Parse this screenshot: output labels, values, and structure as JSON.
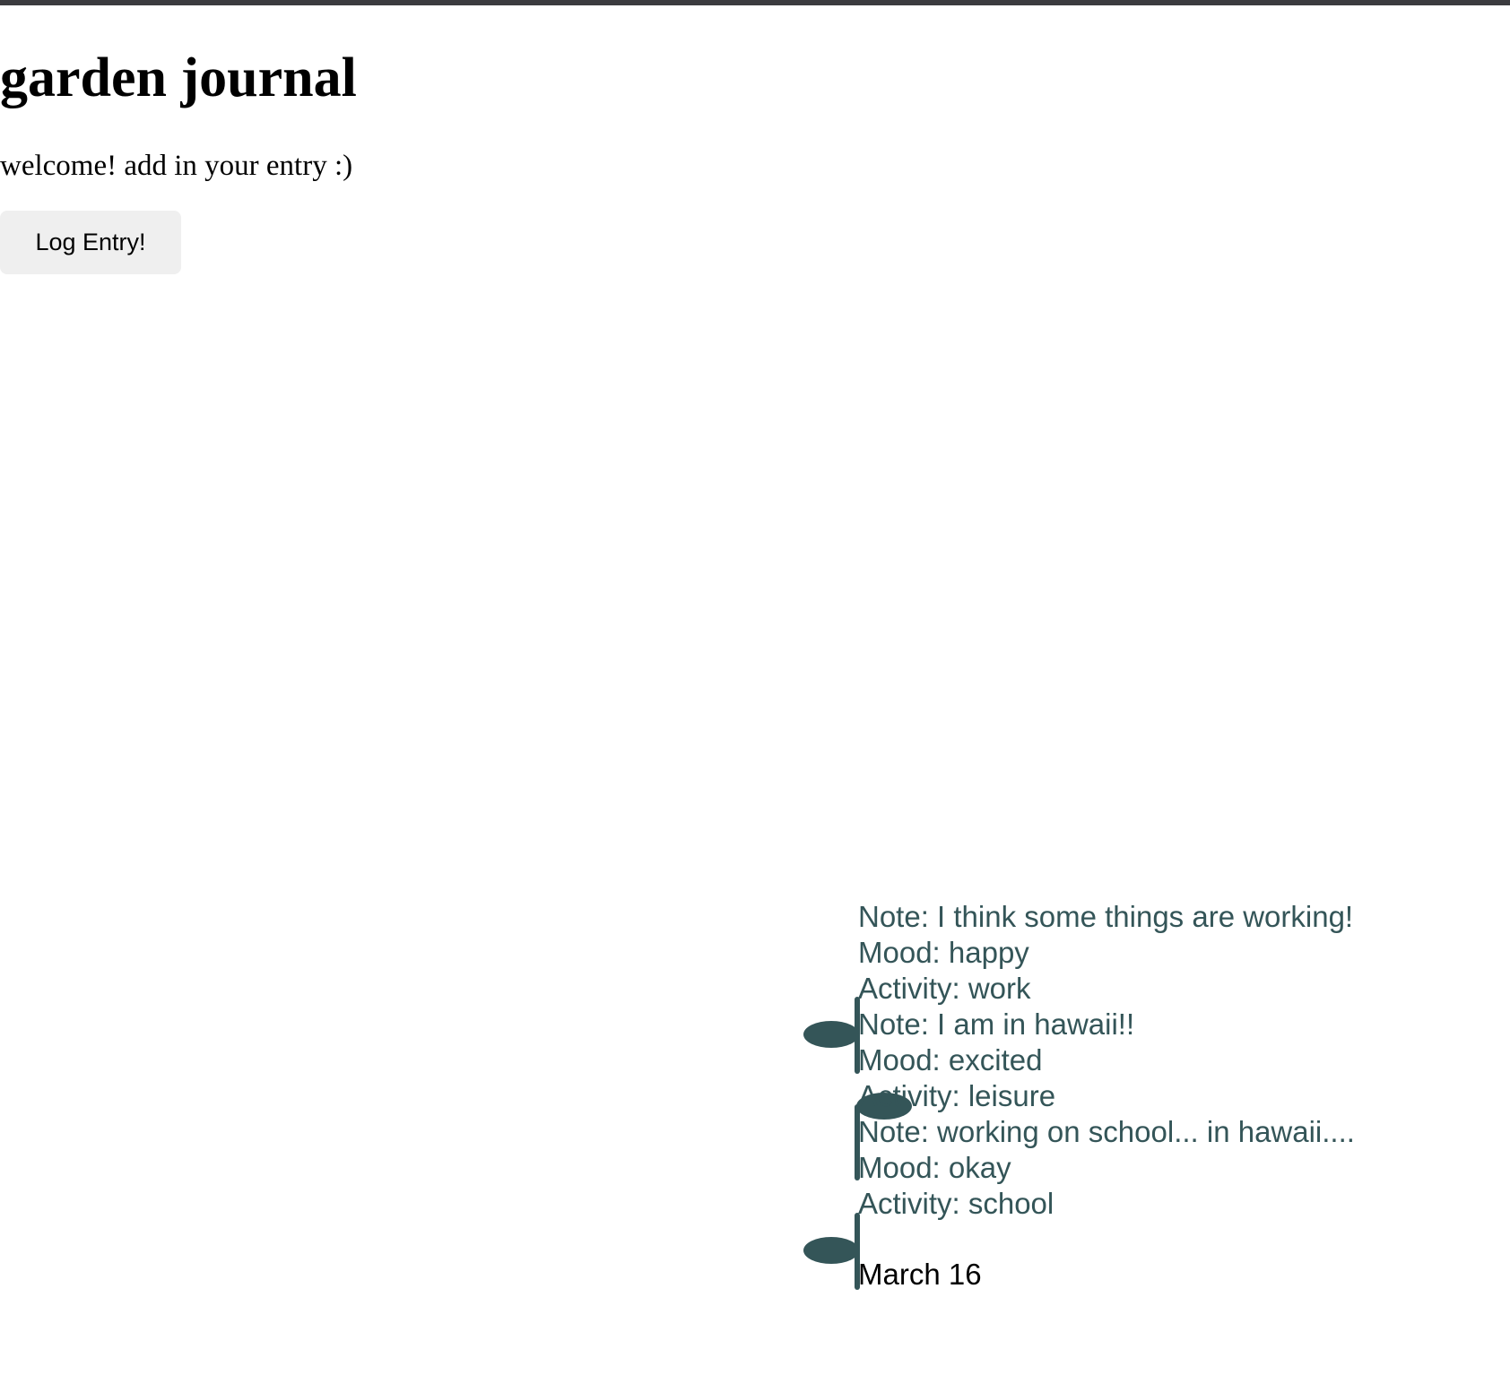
{
  "header": {
    "title": "garden journal",
    "welcome": "welcome! add in your entry :)",
    "log_button_label": "Log Entry!"
  },
  "entries": [
    {
      "note": "Note: I think some things are working!",
      "mood": "Mood: happy",
      "activity": "Activity: work"
    },
    {
      "note": "Note: I am in hawaii!!",
      "mood": "Mood: excited",
      "activity": "Activity: leisure"
    },
    {
      "note": "Note: working on school... in hawaii....",
      "mood": "Mood: okay",
      "activity": "Activity: school"
    }
  ],
  "date": "March 16",
  "colors": {
    "plant": "#345558",
    "entry_text": "#345558",
    "button_bg": "#efefef"
  },
  "icons": {
    "plant": "sprout-icon"
  }
}
